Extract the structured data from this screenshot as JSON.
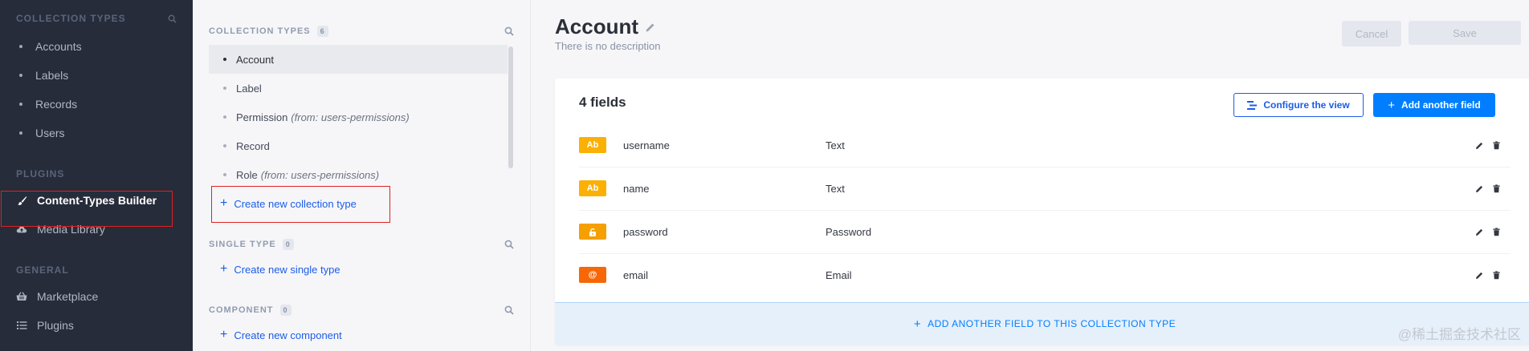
{
  "leftnav": {
    "collection_title": "COLLECTION TYPES",
    "collection_items": [
      {
        "label": "Accounts"
      },
      {
        "label": "Labels"
      },
      {
        "label": "Records"
      },
      {
        "label": "Users"
      }
    ],
    "plugins_title": "PLUGINS",
    "plugins_items": [
      {
        "label": "Content-Types Builder",
        "icon": "brush-icon"
      },
      {
        "label": "Media Library",
        "icon": "cloud-upload-icon"
      }
    ],
    "general_title": "GENERAL",
    "general_items": [
      {
        "label": "Marketplace",
        "icon": "basket-icon"
      },
      {
        "label": "Plugins",
        "icon": "list-icon"
      }
    ]
  },
  "midpanel": {
    "collection": {
      "title": "COLLECTION TYPES",
      "count": "6",
      "items": [
        {
          "label": "Account",
          "from": ""
        },
        {
          "label": "Label",
          "from": ""
        },
        {
          "label": "Permission",
          "from": "(from: users-permissions)"
        },
        {
          "label": "Record",
          "from": ""
        },
        {
          "label": "Role",
          "from": "(from: users-permissions)"
        }
      ],
      "create_label": "Create new collection type"
    },
    "single": {
      "title": "SINGLE TYPE",
      "count": "0",
      "create_label": "Create new single type"
    },
    "component": {
      "title": "COMPONENT",
      "count": "0",
      "create_label": "Create new component"
    }
  },
  "main": {
    "title": "Account",
    "description": "There is no description",
    "cancel_label": "Cancel",
    "save_label": "Save",
    "fields_count_label": "4 fields",
    "configure_label": "Configure the view",
    "add_field_label": "Add another field",
    "fields": [
      {
        "badge": "Ab",
        "name": "username",
        "type": "Text",
        "color": "#fab005"
      },
      {
        "badge": "Ab",
        "name": "name",
        "type": "Text",
        "color": "#fab005"
      },
      {
        "badge": "🔓",
        "name": "password",
        "type": "Password",
        "color": "#f59f00"
      },
      {
        "badge": "@",
        "name": "email",
        "type": "Email",
        "color": "#f76707"
      }
    ],
    "add_bottom_label": "ADD ANOTHER FIELD TO THIS COLLECTION TYPE"
  },
  "watermark": "@稀土掘金技术社区",
  "colors": {
    "accent": "#007eff",
    "nav_bg": "#262c3a",
    "highlight_red": "#e02121"
  }
}
